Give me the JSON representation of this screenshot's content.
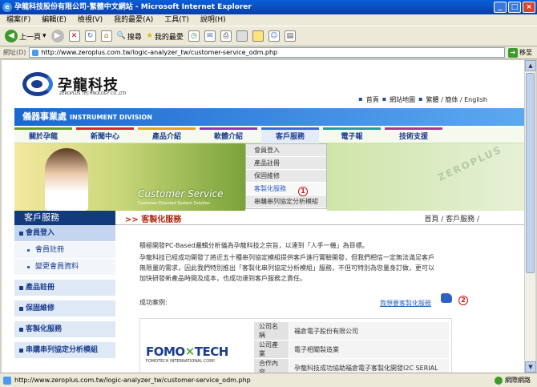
{
  "window": {
    "title": "孕龍科技股份有限公司-繁體中文網站 - Microsoft Internet Explorer",
    "ie_icon": "ie-icon",
    "buttons": {
      "min": "_",
      "max": "□",
      "close": "×"
    }
  },
  "menu": [
    "檔案(F)",
    "編輯(E)",
    "檢視(V)",
    "我的最愛(A)",
    "工具(T)",
    "說明(H)"
  ],
  "toolbar": {
    "back": "上一頁",
    "search": "搜尋",
    "favorites": "我的最愛"
  },
  "address": {
    "label": "網址(D)",
    "url": "http://www.zeroplus.com.tw/logic-analyzer_tw/customer-service_odm.php",
    "go": "移至"
  },
  "status": {
    "text": "http://www.zeroplus.com.tw/logic-analyzer_tw/customer-service_odm.php",
    "zone": "網際網路"
  },
  "brand": {
    "name": "孕龍科技",
    "english": "ZEROPLUS TECHNOLOGY CO.,LTD"
  },
  "toplinks": {
    "home": "首頁",
    "sitemap": "網站地圖",
    "lang": "繁體 / 簡体 / English"
  },
  "division": {
    "zh": "儀器事業處",
    "en": "INSTRUMENT DIVISION"
  },
  "nav": [
    {
      "label": "關於孕龍",
      "color": "#6a9a2a"
    },
    {
      "label": "新聞中心",
      "color": "#d02a2a"
    },
    {
      "label": "產品介紹",
      "color": "#e0a020"
    },
    {
      "label": "軟體介紹",
      "color": "#8a3aa8"
    },
    {
      "label": "客戶服務",
      "color": "#3c6ac8"
    },
    {
      "label": "電子報",
      "color": "#2a9a9a"
    },
    {
      "label": "技術支援",
      "color": "#a83a8a"
    }
  ],
  "dropdown": [
    "會員登入",
    "產品註冊",
    "保固維修",
    "客製化服務",
    "串購串列協定分析模組"
  ],
  "markers": [
    "1",
    "2"
  ],
  "banner": {
    "title": "Customer Service",
    "subtitle": "Customer-Oriented System Solution",
    "watermark": "ZEROPLUS"
  },
  "side": {
    "heading": "客戶服務",
    "items": [
      {
        "label": "會員登入",
        "kind": "first"
      },
      {
        "label": "會員註冊",
        "kind": "sub"
      },
      {
        "label": "變更會員資料",
        "kind": "sub"
      },
      {
        "label": "產品註冊",
        "kind": "main"
      },
      {
        "label": "保固維修",
        "kind": "main"
      },
      {
        "label": "客製化服務",
        "kind": "main"
      },
      {
        "label": "串購串列協定分析模組",
        "kind": "main"
      }
    ]
  },
  "section": {
    "title": ">> 客製化服務",
    "path": "首頁 / 客戶服務 /"
  },
  "body": {
    "p1": "積極開發PC-Based邏輯分析儀為孕龍科技之宗旨，以達到「人手一機」為目標。",
    "p2": "孕龍科技已經成功開發了將近五十種串列協定模組提供客戶進行實驗開發，但我們相信一定無法滿足客戶",
    "p3": "無限量的需求，因此我們特別推出「客製化串列協定分析模組」服務，不但可特別為您量身訂做，更可以",
    "p4": "加快研發新產品時間及成本，也成功達到客戶服務之責任。",
    "cases": "成功案例:",
    "want": "我想要客製化服務"
  },
  "case": {
    "logo_a": "FOMO",
    "logo_x": "✕",
    "logo_b": "TECH",
    "logo_sub": "FOMOTECH INTERNATIONAL CORP.",
    "rows": [
      {
        "k": "公司名稱",
        "v": "福倉電子股份有限公司"
      },
      {
        "k": "公司產業",
        "v": "電子相關製造業"
      },
      {
        "k": "合作內容",
        "v": "孕龍科技成功協助福倉電子客製化開發I2C SERIAL"
      }
    ]
  }
}
